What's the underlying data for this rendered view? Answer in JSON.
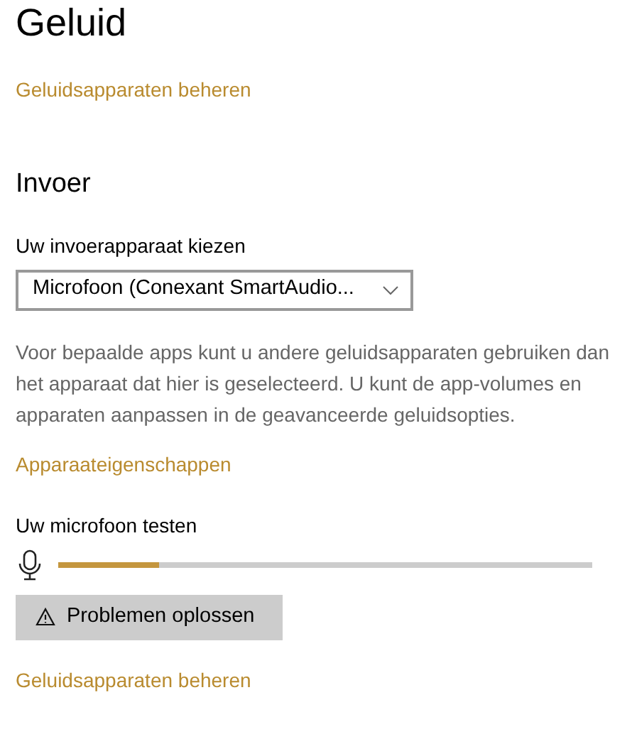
{
  "page_title": "Geluid",
  "top_link": "Geluidsapparaten beheren",
  "section_title": "Invoer",
  "device_label": "Uw invoerapparaat kiezen",
  "device_dropdown": {
    "value": "Microfoon (Conexant SmartAudio..."
  },
  "description": "Voor bepaalde apps kunt u andere geluidsapparaten gebruiken dan het apparaat dat hier is geselecteerd. U kunt de app-volumes en apparaten aanpassen in de geavanceerde geluidsopties.",
  "properties_link": "Apparaateigenschappen",
  "test_label": "Uw microfoon testen",
  "mic_meter": {
    "level": 0.19
  },
  "troubleshoot_button": "Problemen oplossen",
  "bottom_link": "Geluidsapparaten beheren"
}
